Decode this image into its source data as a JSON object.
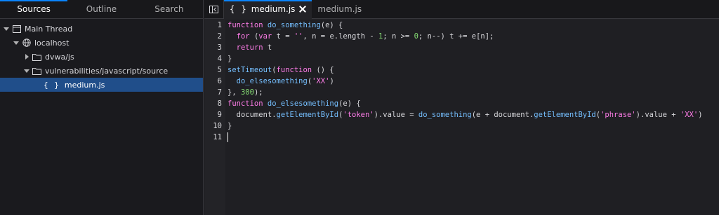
{
  "left_tabs": [
    "Sources",
    "Outline",
    "Search"
  ],
  "tree": {
    "main_thread": "Main Thread",
    "host": "localhost",
    "folder1": "dvwa/js",
    "folder2": "vulnerabilities/javascript/source",
    "file": "medium.js",
    "file_glyph": "{ }"
  },
  "editor_tabs": [
    {
      "glyph": "{ }",
      "label": "medium.js"
    },
    {
      "label": "medium.js"
    }
  ],
  "line_numbers": [
    "1",
    "2",
    "3",
    "4",
    "5",
    "6",
    "7",
    "8",
    "9",
    "10",
    "11"
  ],
  "code_lines": [
    [
      {
        "t": "kw",
        "v": "function"
      },
      {
        "t": "plain",
        "v": " "
      },
      {
        "t": "fn",
        "v": "do_something"
      },
      {
        "t": "plain",
        "v": "(e) {"
      }
    ],
    [
      {
        "t": "plain",
        "v": "  "
      },
      {
        "t": "kw",
        "v": "for"
      },
      {
        "t": "plain",
        "v": " ("
      },
      {
        "t": "kw",
        "v": "var"
      },
      {
        "t": "plain",
        "v": " t = "
      },
      {
        "t": "str",
        "v": "''"
      },
      {
        "t": "plain",
        "v": ", n = e.length - "
      },
      {
        "t": "num",
        "v": "1"
      },
      {
        "t": "plain",
        "v": "; n >= "
      },
      {
        "t": "num",
        "v": "0"
      },
      {
        "t": "plain",
        "v": "; n--) t += e[n];"
      }
    ],
    [
      {
        "t": "plain",
        "v": "  "
      },
      {
        "t": "kw",
        "v": "return"
      },
      {
        "t": "plain",
        "v": " t"
      }
    ],
    [
      {
        "t": "plain",
        "v": "}"
      }
    ],
    [
      {
        "t": "fn",
        "v": "setTimeout"
      },
      {
        "t": "plain",
        "v": "("
      },
      {
        "t": "kw",
        "v": "function"
      },
      {
        "t": "plain",
        "v": " () {"
      }
    ],
    [
      {
        "t": "plain",
        "v": "  "
      },
      {
        "t": "fn",
        "v": "do_elsesomething"
      },
      {
        "t": "plain",
        "v": "("
      },
      {
        "t": "str",
        "v": "'XX'"
      },
      {
        "t": "plain",
        "v": ")"
      }
    ],
    [
      {
        "t": "plain",
        "v": "}, "
      },
      {
        "t": "num",
        "v": "300"
      },
      {
        "t": "plain",
        "v": ");"
      }
    ],
    [
      {
        "t": "kw",
        "v": "function"
      },
      {
        "t": "plain",
        "v": " "
      },
      {
        "t": "fn",
        "v": "do_elsesomething"
      },
      {
        "t": "plain",
        "v": "(e) {"
      }
    ],
    [
      {
        "t": "plain",
        "v": "  document."
      },
      {
        "t": "fn",
        "v": "getElementById"
      },
      {
        "t": "plain",
        "v": "("
      },
      {
        "t": "str",
        "v": "'token'"
      },
      {
        "t": "plain",
        "v": ").value = "
      },
      {
        "t": "fn",
        "v": "do_something"
      },
      {
        "t": "plain",
        "v": "(e + document."
      },
      {
        "t": "fn",
        "v": "getElementById"
      },
      {
        "t": "plain",
        "v": "("
      },
      {
        "t": "str",
        "v": "'phrase'"
      },
      {
        "t": "plain",
        "v": ").value + "
      },
      {
        "t": "str",
        "v": "'XX'"
      },
      {
        "t": "plain",
        "v": ")"
      }
    ],
    [
      {
        "t": "plain",
        "v": "}"
      }
    ],
    []
  ],
  "colors": {
    "accent": "#0a84ff",
    "selection": "#204e8a",
    "keyword": "#ff7de9",
    "function": "#75bfff",
    "number": "#86de74"
  }
}
